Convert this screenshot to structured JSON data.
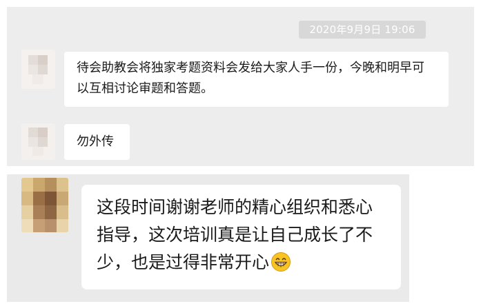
{
  "chat": {
    "timestamp": "2020年9月9日 19:06",
    "messages": [
      {
        "text": "待会助教会将独家考题资料会发给大家人手一份，今晚和明早可以互相讨论审题和答题。"
      },
      {
        "text": "勿外传"
      },
      {
        "text": "这段时间谢谢老师的精心组织和悉心指导，这次培训真是让自己成长了不少，也是过得非常开心",
        "emoji": "grinning-face-emoji"
      }
    ],
    "colors": {
      "chat_background": "#ededed",
      "bubble": "#ffffff",
      "timestamp_pill": "#d8d8d8",
      "text": "#1a1a1a"
    }
  }
}
